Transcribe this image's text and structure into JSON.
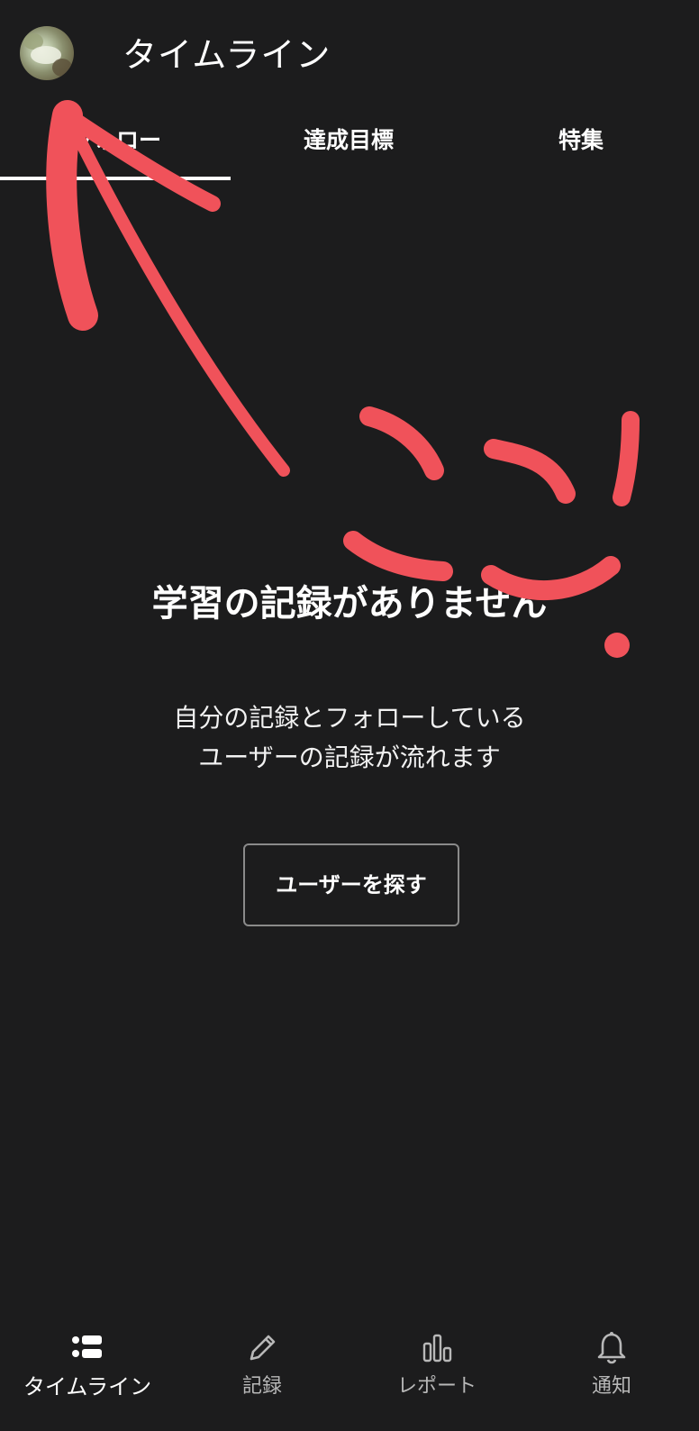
{
  "header": {
    "title": "タイムライン",
    "avatar": "user-avatar"
  },
  "tabs": [
    {
      "label": "フォロー",
      "active": true
    },
    {
      "label": "達成目標",
      "active": false
    },
    {
      "label": "特集",
      "active": false
    }
  ],
  "empty_state": {
    "title": "学習の記録がありません",
    "description_lines": [
      "自分の記録とフォローしている",
      "ユーザーの記録が流れます"
    ],
    "button_label": "ユーザーを探す"
  },
  "bottom_nav": [
    {
      "label": "タイムライン",
      "icon": "timeline-icon",
      "active": true
    },
    {
      "label": "記録",
      "icon": "pencil-icon",
      "active": false
    },
    {
      "label": "レポート",
      "icon": "bar-chart-icon",
      "active": false
    },
    {
      "label": "通知",
      "icon": "bell-icon",
      "active": false
    }
  ],
  "annotation": {
    "text": "ここ!",
    "color": "#f0525a"
  },
  "colors": {
    "background": "#1c1c1d",
    "text": "#ffffff",
    "inactive": "#b8b8b8"
  }
}
